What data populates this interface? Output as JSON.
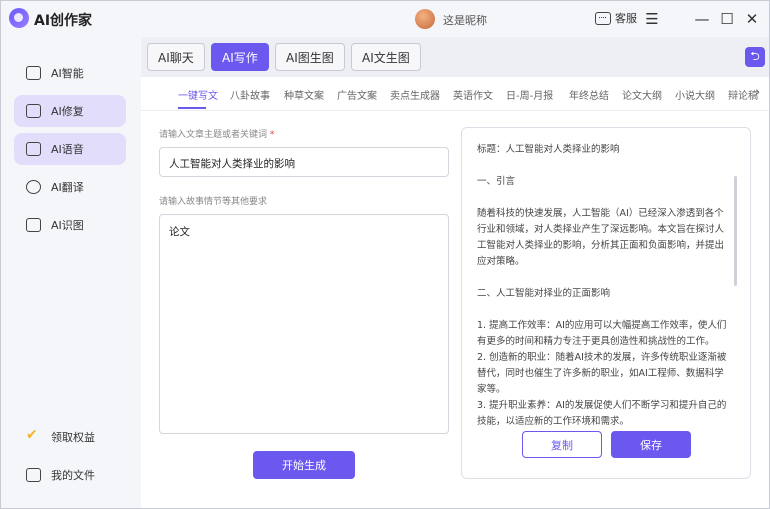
{
  "app": {
    "title": "AI创作家",
    "nickname": "这是昵称",
    "service_label": "客服"
  },
  "window_controls": {
    "menu": "☰",
    "minimize": "—",
    "maximize": "☐",
    "close": "✕"
  },
  "sidebar": {
    "items": [
      {
        "label": "AI智能",
        "icon": "chat-icon"
      },
      {
        "label": "AI修复",
        "icon": "image-edit-icon"
      },
      {
        "label": "AI语音",
        "icon": "voice-icon"
      },
      {
        "label": "AI翻译",
        "icon": "translate-icon"
      },
      {
        "label": "AI识图",
        "icon": "image-recognize-icon"
      }
    ],
    "bottom": [
      {
        "label": "领取权益",
        "icon": "gift-icon"
      },
      {
        "label": "我的文件",
        "icon": "file-icon"
      }
    ]
  },
  "top_tabs": [
    "AI聊天",
    "AI写作",
    "AI图生图",
    "AI文生图"
  ],
  "logout_icon": "⮌",
  "sub_tabs": [
    "一键写文",
    "八卦故事",
    "种草文案",
    "广告文案",
    "卖点生成器",
    "英语作文",
    "日-周-月报",
    "年终总结",
    "论文大纲",
    "小说大纲",
    "辩论稿"
  ],
  "form": {
    "topic_label": "请输入文章主题或者关键词",
    "required_mark": "*",
    "topic_value": "人工智能对人类择业的影响",
    "detail_label": "请输入故事情节等其他要求",
    "detail_value": "论文",
    "generate_button": "开始生成"
  },
  "output": {
    "lines": [
      "标题：人工智能对人类择业的影响",
      "",
      "一、引言",
      "",
      "随着科技的快速发展，人工智能（AI）已经深入渗透到各个行业和领域，对人类择业产生了深远影响。本文旨在探讨人工智能对人类择业的影响，分析其正面和负面影响，并提出应对策略。",
      "",
      "二、人工智能对择业的正面影响",
      "",
      "1. 提高工作效率：AI的应用可以大幅提高工作效率，使人们有更多的时间和精力专注于更具创造性和挑战性的工作。",
      "2. 创造新的职业：随着AI技术的发展，许多传统职业逐渐被替代，同时也催生了许多新的职业，如AI工程师、数据科学家等。",
      "3. 提升职业素养：AI的发展促使人们不断学习和提升自己的技能，以适应新的工作环境和需求。"
    ],
    "copy_button": "复制",
    "save_button": "保存"
  },
  "colors": {
    "accent": "#6b58ee",
    "active_sidebar_bg": "#e2ddfb",
    "required": "#e0443a"
  }
}
